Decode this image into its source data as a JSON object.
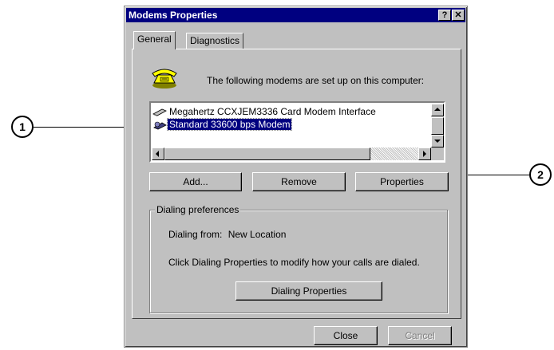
{
  "window": {
    "title": "Modems Properties",
    "help_button": "?",
    "close_button": "✕"
  },
  "tabs": [
    {
      "label": "General"
    },
    {
      "label": "Diagnostics"
    }
  ],
  "general": {
    "info_text": "The following modems are set up on this computer:",
    "modems": [
      {
        "label": "Megahertz CCXJEM3336 Card Modem Interface"
      },
      {
        "label": "Standard 33600 bps Modem"
      }
    ]
  },
  "buttons": {
    "add": "Add...",
    "remove": "Remove",
    "properties": "Properties"
  },
  "dialing": {
    "group_label": "Dialing preferences",
    "dialing_from_label": "Dialing from:",
    "dialing_from_value": "New Location",
    "description": "Click Dialing Properties to modify how your calls are dialed.",
    "dialing_properties_button": "Dialing Properties"
  },
  "footer": {
    "close": "Close",
    "cancel": "Cancel"
  },
  "callouts": [
    {
      "number": "1"
    },
    {
      "number": "2"
    }
  ]
}
